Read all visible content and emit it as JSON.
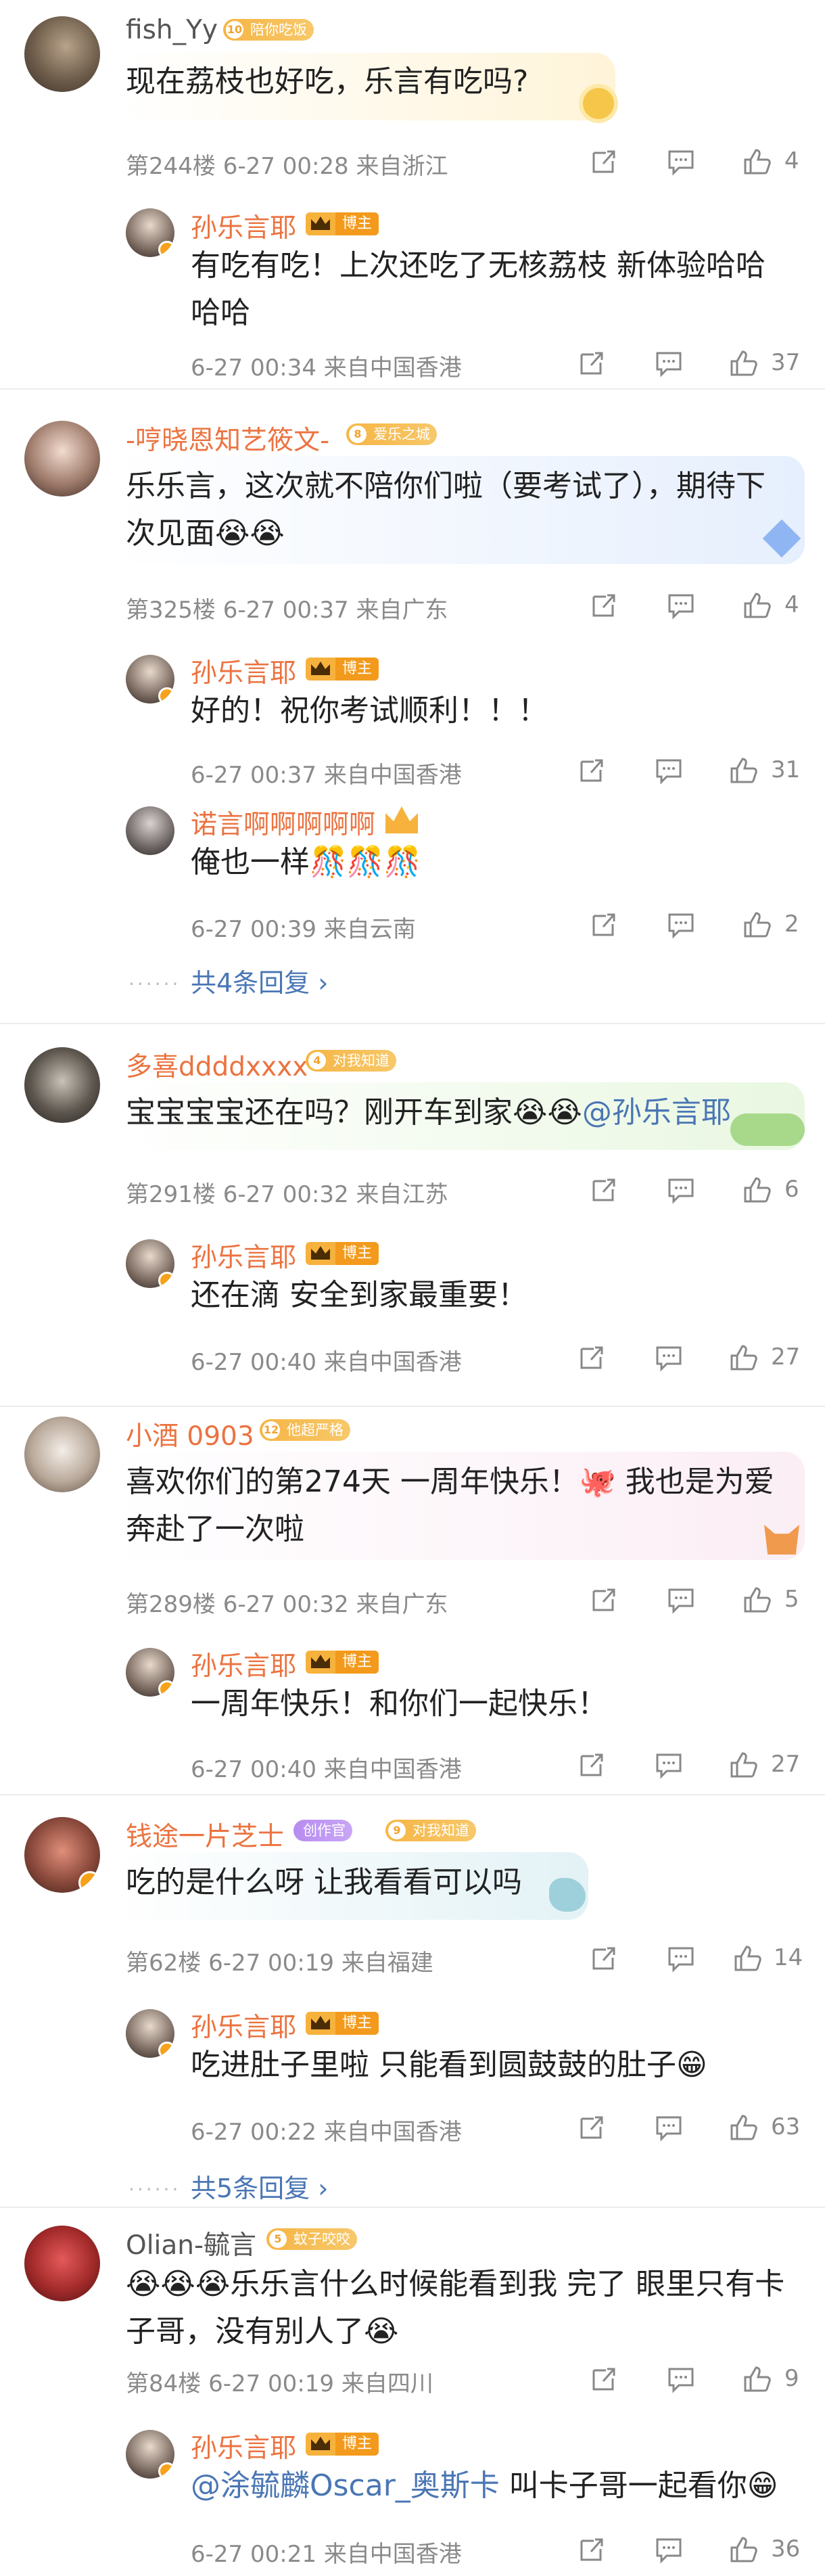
{
  "comments": [
    {
      "user": "fish_Yy",
      "level_num": "10",
      "level_label": "陪你吃饭",
      "text": "现在荔枝也好吃，乐言有吃吗?",
      "floor": "第244楼",
      "time": "6-27 00:28",
      "location": "来自浙江",
      "likes": "4",
      "replies": [
        {
          "user": "孙乐言耶",
          "badge": "博主",
          "text": "有吃有吃！上次还吃了无核荔枝 新体验哈哈哈哈",
          "time": "6-27 00:34",
          "location": "来自中国香港",
          "likes": "37"
        }
      ]
    },
    {
      "user": "-哼晓恩知艺筱文-",
      "level_num": "8",
      "level_label": "爱乐之城",
      "text": "乐乐言，这次就不陪你们啦（要考试了），期待下次见面😭😭",
      "floor": "第325楼",
      "time": "6-27 00:37",
      "location": "来自广东",
      "likes": "4",
      "replies": [
        {
          "user": "孙乐言耶",
          "badge": "博主",
          "text": "好的！祝你考试顺利！！！",
          "time": "6-27 00:37",
          "location": "来自中国香港",
          "likes": "31"
        },
        {
          "user": "诺言啊啊啊啊啊",
          "badge": "",
          "text": "俺也一样🎊🎊🎊",
          "time": "6-27 00:39",
          "location": "来自云南",
          "likes": "2"
        }
      ],
      "more_replies": "共4条回复"
    },
    {
      "user": "多喜ddddxxxx",
      "level_num": "4",
      "level_label": "对我知道",
      "text": "宝宝宝宝还在吗？刚开车到家😭😭",
      "mention": "@孙乐言耶",
      "floor": "第291楼",
      "time": "6-27 00:32",
      "location": "来自江苏",
      "likes": "6",
      "replies": [
        {
          "user": "孙乐言耶",
          "badge": "博主",
          "text": "还在滴 安全到家最重要！",
          "time": "6-27 00:40",
          "location": "来自中国香港",
          "likes": "27"
        }
      ]
    },
    {
      "user": "小酒 0903",
      "level_num": "12",
      "level_label": "他超严格",
      "text": "喜欢你们的第274天 一周年快乐！🐙 我也是为爱奔赴了一次啦",
      "floor": "第289楼",
      "time": "6-27 00:32",
      "location": "来自广东",
      "likes": "5",
      "replies": [
        {
          "user": "孙乐言耶",
          "badge": "博主",
          "text": "一周年快乐！和你们一起快乐！",
          "time": "6-27 00:40",
          "location": "来自中国香港",
          "likes": "27"
        }
      ]
    },
    {
      "user": "钱途一片芝士",
      "level_num": "9",
      "level_label": "对我知道",
      "level2_label": "创作官",
      "text": "吃的是什么呀 让我看看可以吗",
      "floor": "第62楼",
      "time": "6-27 00:19",
      "location": "来自福建",
      "likes": "14",
      "replies": [
        {
          "user": "孙乐言耶",
          "badge": "博主",
          "text": "吃进肚子里啦 只能看到圆鼓鼓的肚子😁",
          "time": "6-27 00:22",
          "location": "来自中国香港",
          "likes": "63"
        }
      ],
      "more_replies": "共5条回复"
    },
    {
      "user": "Olian-毓言",
      "level_num": "5",
      "level_label": "蚊子咬咬",
      "text": "😭😭😭乐乐言什么时候能看到我 完了 眼里只有卡子哥，没有别人了😭",
      "floor": "第84楼",
      "time": "6-27 00:19",
      "location": "来自四川",
      "likes": "9",
      "replies": [
        {
          "user": "孙乐言耶",
          "badge": "博主",
          "mention": "@涂毓麟Oscar_奥斯卡",
          "text": " 叫卡子哥一起看你😁",
          "time": "6-27 00:21",
          "location": "来自中国香港",
          "likes": "36"
        }
      ]
    }
  ],
  "colors": {
    "name": "#eb7340",
    "mention": "#4a76b4",
    "meta": "#8a8a8a"
  },
  "icons": [
    "share-icon",
    "comment-icon",
    "like-icon",
    "chevron-right-icon"
  ]
}
